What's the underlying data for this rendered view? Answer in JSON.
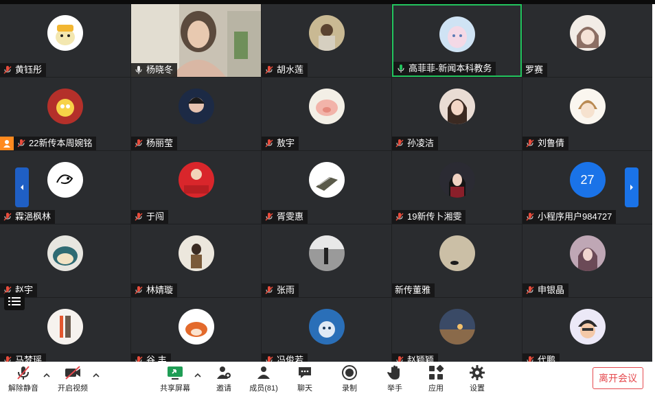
{
  "participants": [
    {
      "name": "黄钰彤",
      "mic": "muted",
      "avatar": "duck-avatar"
    },
    {
      "name": "杨晓冬",
      "mic": "on",
      "avatar": "video-feed"
    },
    {
      "name": "胡水莲",
      "mic": "muted",
      "avatar": "photo-avatar"
    },
    {
      "name": "高菲菲-新闻本科教务",
      "mic": "speaking",
      "avatar": "anime-avatar"
    },
    {
      "name": "罗赛",
      "mic": "none",
      "avatar": "cartoon-avatar"
    },
    {
      "name": "22新传本周婉铭",
      "mic": "muted",
      "avatar": "cartoon-avatar",
      "host": true
    },
    {
      "name": "杨丽莹",
      "mic": "muted",
      "avatar": "photo-avatar"
    },
    {
      "name": "敖宇",
      "mic": "muted",
      "avatar": "pig-avatar"
    },
    {
      "name": "孙凌洁",
      "mic": "muted",
      "avatar": "photo-avatar"
    },
    {
      "name": "刘鲁倩",
      "mic": "muted",
      "avatar": "anime-avatar"
    },
    {
      "name": "霖浥枫林",
      "mic": "muted",
      "avatar": "sketch-avatar"
    },
    {
      "name": "于闯",
      "mic": "muted",
      "avatar": "flag-avatar"
    },
    {
      "name": "胥雯惠",
      "mic": "muted",
      "avatar": "sketch-avatar"
    },
    {
      "name": "19新传卜湘雯",
      "mic": "muted",
      "avatar": "photo-avatar"
    },
    {
      "name": "小程序用户984727",
      "mic": "muted",
      "avatar": "number-avatar",
      "avatar_text": "27"
    },
    {
      "name": "赵宇",
      "mic": "muted",
      "avatar": "snorlax-avatar"
    },
    {
      "name": "林婧璇",
      "mic": "muted",
      "avatar": "photo-avatar"
    },
    {
      "name": "张雨",
      "mic": "muted",
      "avatar": "photo-avatar"
    },
    {
      "name": "新传董雅",
      "mic": "none",
      "avatar": "photo-avatar"
    },
    {
      "name": "申银晶",
      "mic": "muted",
      "avatar": "photo-avatar"
    },
    {
      "name": "马梦瑶",
      "mic": "muted",
      "avatar": "photo-avatar"
    },
    {
      "name": "谷 丰",
      "mic": "muted",
      "avatar": "fox-avatar"
    },
    {
      "name": "冯俊若",
      "mic": "muted",
      "avatar": "photo-avatar"
    },
    {
      "name": "赵颖颖",
      "mic": "muted",
      "avatar": "photo-avatar"
    },
    {
      "name": "代鹏",
      "mic": "muted",
      "avatar": "cartoon-avatar"
    }
  ],
  "avatar_label_27": "27",
  "toolbar": {
    "unmute": "解除静音",
    "start_video": "开启视频",
    "share_screen": "共享屏幕",
    "invite": "邀请",
    "members": "成员(81)",
    "chat": "聊天",
    "record": "录制",
    "raise_hand": "举手",
    "apps": "应用",
    "settings": "设置",
    "leave": "离开会议"
  },
  "colors": {
    "speaking_border": "#22c55e",
    "leave_red": "#e5484d",
    "accent_blue": "#1a73e8",
    "host_orange": "#ff8a1f"
  }
}
